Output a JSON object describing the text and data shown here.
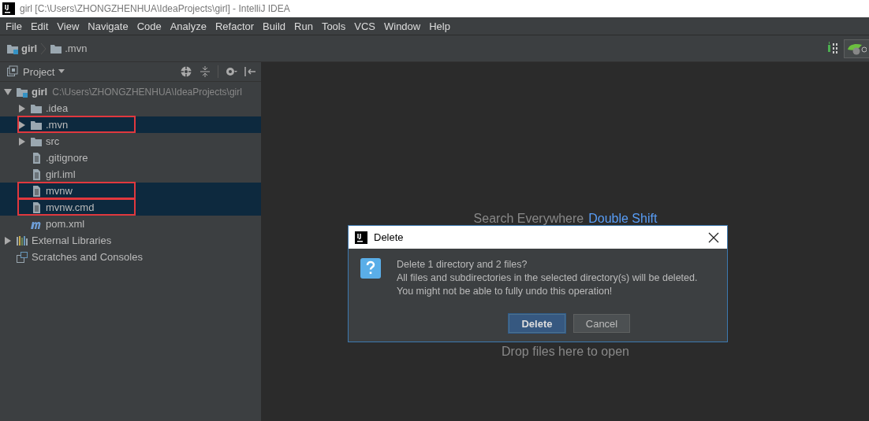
{
  "window": {
    "title": "girl [C:\\Users\\ZHONGZHENHUA\\IdeaProjects\\girl] - IntelliJ IDEA"
  },
  "menu": [
    {
      "label": "File"
    },
    {
      "label": "Edit"
    },
    {
      "label": "View"
    },
    {
      "label": "Navigate"
    },
    {
      "label": "Code"
    },
    {
      "label": "Analyze"
    },
    {
      "label": "Refactor"
    },
    {
      "label": "Build"
    },
    {
      "label": "Run"
    },
    {
      "label": "Tools"
    },
    {
      "label": "VCS"
    },
    {
      "label": "Window"
    },
    {
      "label": "Help"
    }
  ],
  "breadcrumbs": [
    {
      "label": "girl",
      "kind": "module"
    },
    {
      "label": ".mvn",
      "kind": "folder"
    }
  ],
  "project_panel": {
    "title": "Project",
    "tree": [
      {
        "label": "girl",
        "kind": "module",
        "path": "C:\\Users\\ZHONGZHENHUA\\IdeaProjects\\girl",
        "expanded": true,
        "selected": false,
        "highlighted": false,
        "children": [
          {
            "label": ".idea",
            "kind": "folder",
            "expanded": false,
            "selected": false,
            "highlighted": false
          },
          {
            "label": ".mvn",
            "kind": "folder",
            "expanded": false,
            "selected": true,
            "highlighted": true
          },
          {
            "label": "src",
            "kind": "folder",
            "expanded": false,
            "selected": false,
            "highlighted": false
          },
          {
            "label": ".gitignore",
            "kind": "file",
            "selected": false,
            "highlighted": false
          },
          {
            "label": "girl.iml",
            "kind": "file",
            "selected": false,
            "highlighted": false
          },
          {
            "label": "mvnw",
            "kind": "file",
            "selected": true,
            "highlighted": true
          },
          {
            "label": "mvnw.cmd",
            "kind": "file",
            "selected": true,
            "highlighted": true
          },
          {
            "label": "pom.xml",
            "kind": "maven",
            "selected": false,
            "highlighted": false
          }
        ]
      },
      {
        "label": "External Libraries",
        "kind": "libraries",
        "expanded": false,
        "selected": false,
        "highlighted": false
      },
      {
        "label": "Scratches and Consoles",
        "kind": "scratches",
        "selected": false,
        "highlighted": false
      }
    ]
  },
  "editor": {
    "hint": "Search Everywhere",
    "shortcut": "Double Shift",
    "drop_hint": "Drop files here to open"
  },
  "dialog": {
    "title": "Delete",
    "message": [
      "Delete 1 directory and 2 files?",
      "All files and subdirectories in the selected directory(s) will be deleted.",
      "You might not be able to fully undo this operation!"
    ],
    "buttons": [
      {
        "label": "Delete",
        "default": true
      },
      {
        "label": "Cancel",
        "default": false
      }
    ]
  }
}
